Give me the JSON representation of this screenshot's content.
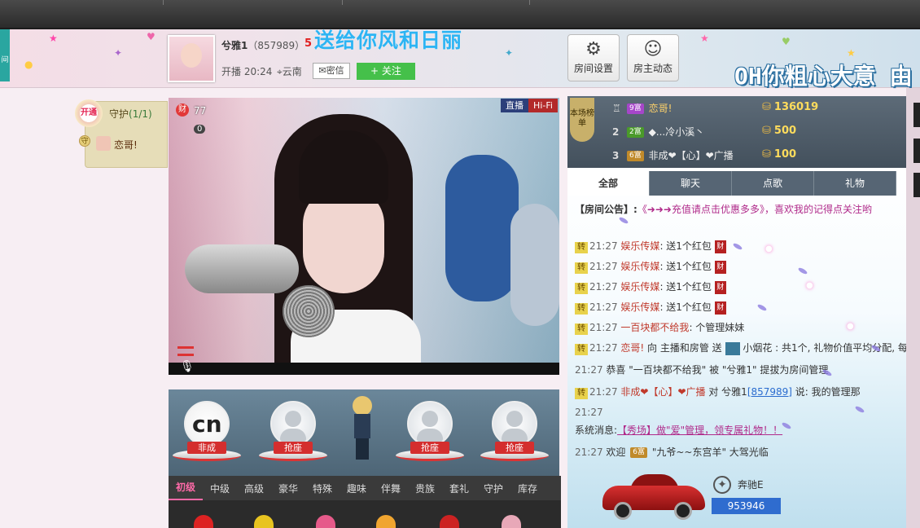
{
  "header": {
    "host_name": "兮雅1",
    "host_id": "（857989）",
    "host_level": "5",
    "gift_banner": "送给你风和日丽",
    "live_time_label": "开播 20:24",
    "location": "云南",
    "msg_button": "密信",
    "follow_button": "关注",
    "room_settings": "房间设置",
    "host_feed": "房主动态",
    "marquee": "OH你粗心大意 由"
  },
  "left_tab": "间",
  "guard": {
    "badge": "开通",
    "title": "守护",
    "count": "(1/1)",
    "shou": "守",
    "user": "恋哥!"
  },
  "video": {
    "badge": "财",
    "viewers": "77",
    "sub_count": "0",
    "live_tag": "直播",
    "hifi_tag": "Hi-Fi"
  },
  "seats": [
    {
      "label": "非成",
      "logo": "cn"
    },
    {
      "label": "抢座"
    },
    {
      "label": "抢座"
    },
    {
      "label": "抢座"
    }
  ],
  "gift_tabs": [
    "初级",
    "中级",
    "高级",
    "豪华",
    "特殊",
    "趣味",
    "伴舞",
    "贵族",
    "套礼",
    "守护",
    "库存"
  ],
  "rank": {
    "badge": "本场榜单",
    "rows": [
      {
        "n": "",
        "level": "9富",
        "level_color": "#a646c9",
        "name": "恋哥!",
        "coins": "136019"
      },
      {
        "n": "2",
        "level": "2富",
        "level_color": "#4a9a2a",
        "name": "◆...冷小溪丶",
        "coins": "500"
      },
      {
        "n": "3",
        "level": "6富",
        "level_color": "#c08a2a",
        "name": "非成❤【心】❤广播",
        "coins": "100"
      }
    ]
  },
  "chat_tabs": [
    "全部",
    "聊天",
    "点歌",
    "礼物"
  ],
  "announcement": {
    "label": "【房间公告】:",
    "text": "《➜➜➜充值请点击优惠多多》，喜欢我的记得点关注哟"
  },
  "messages": [
    {
      "tz": "转",
      "time": "21:27",
      "user": "娱乐传媒",
      "text": ": 送1个红包",
      "icon": "财"
    },
    {
      "tz": "转",
      "time": "21:27",
      "user": "娱乐传媒",
      "text": ": 送1个红包",
      "icon": "财"
    },
    {
      "tz": "转",
      "time": "21:27",
      "user": "娱乐传媒",
      "text": ": 送1个红包",
      "icon": "财"
    },
    {
      "tz": "转",
      "time": "21:27",
      "user": "娱乐传媒",
      "text": ": 送1个红包",
      "icon": "财"
    },
    {
      "tz": "转",
      "time": "21:27",
      "user": "一百块都不给我",
      "text": ": 个管理妹妹"
    },
    {
      "tz": "转",
      "time": "21:27",
      "user": "恋哥!",
      "text": " 向 主播和房管 送",
      "extra": "小烟花 : 共1个, 礼物价值平均分配, 每"
    },
    {
      "time": "21:27",
      "text": "恭喜 \"一百块都不给我\" 被 \"兮雅1\" 提拔为房间管理"
    },
    {
      "tz": "转",
      "time": "21:27",
      "user": "非成❤【心】❤广播",
      "text": " 对 兮雅1",
      "link": "[857989]",
      "tail": " 说: 我的管理那"
    },
    {
      "time": "21:27",
      "text": ""
    },
    {
      "prefix": "系统消息:",
      "text": "【秀场】做\"爱\"管理，领专属礼物！！"
    },
    {
      "time": "21:27",
      "text": "欢迎",
      "level": "6富",
      "tail": "\"九爷~~东宫羊\" 大驾光临"
    }
  ],
  "car": {
    "name": "奔驰E",
    "id": "953946"
  }
}
